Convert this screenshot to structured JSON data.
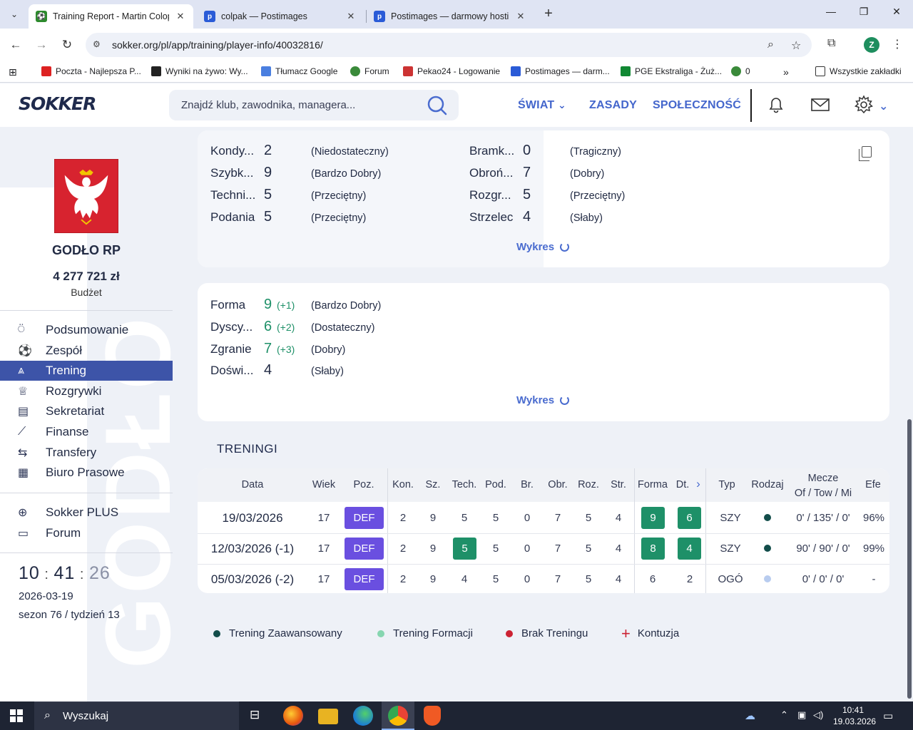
{
  "browser": {
    "tabs": [
      {
        "title": "Training Report - Martin Colopa",
        "active": true
      },
      {
        "title": "colpak — Postimages",
        "active": false
      },
      {
        "title": "Postimages — darmowy hosting",
        "active": false
      }
    ],
    "url": "sokker.org/pl/app/training/player-info/40032816/",
    "profile_initial": "Z",
    "bookmarks": [
      {
        "label": "Poczta - Najlepsza P...",
        "color": "#d22"
      },
      {
        "label": "Wyniki na żywo: Wy...",
        "color": "#222"
      },
      {
        "label": "Tłumacz Google",
        "color": "#4a7fe0"
      },
      {
        "label": "Forum",
        "color": "#3a8a3a"
      },
      {
        "label": "Pekao24 - Logowanie",
        "color": "#c33"
      },
      {
        "label": "Postimages — darm...",
        "color": "#2a5bd7"
      },
      {
        "label": "PGE Ekstraliga - Żuż...",
        "color": "#118833"
      },
      {
        "label": "0",
        "color": "#3a8a3a"
      }
    ],
    "all_bookmarks": "Wszystkie zakładki"
  },
  "header": {
    "logo": "SOKKER",
    "search_placeholder": "Znajdź klub, zawodnika, managera...",
    "nav": [
      "ŚWIAT",
      "ZASADY",
      "SPOŁECZNOŚĆ"
    ]
  },
  "sidebar": {
    "club_name": "GODŁO RP",
    "money": "4 277 721 zł",
    "budget_label": "Budżet",
    "watermark": "GODŁO",
    "menu": [
      {
        "label": "Podsumowanie",
        "icon": "medal-icon",
        "glyph": "⍥"
      },
      {
        "label": "Zespół",
        "icon": "ball-icon",
        "glyph": "⚽"
      },
      {
        "label": "Trening",
        "icon": "cone-icon",
        "glyph": "⩓",
        "active": true
      },
      {
        "label": "Rozgrywki",
        "icon": "trophy-icon",
        "glyph": "♕"
      },
      {
        "label": "Sekretariat",
        "icon": "briefcase-icon",
        "glyph": "▤"
      },
      {
        "label": "Finanse",
        "icon": "chart-icon",
        "glyph": "⟋"
      },
      {
        "label": "Transfery",
        "icon": "transfer-icon",
        "glyph": "⇆"
      },
      {
        "label": "Biuro Prasowe",
        "icon": "newspaper-icon",
        "glyph": "▦"
      }
    ],
    "menu2": [
      {
        "label": "Sokker PLUS",
        "icon": "plus-circle-icon",
        "glyph": "⊕"
      },
      {
        "label": "Forum",
        "icon": "chat-icon",
        "glyph": "▭"
      }
    ],
    "clock": {
      "h": "10",
      "m": "41",
      "s": "26"
    },
    "date": "2026-03-19",
    "season": "sezon 76 / tydzień 13"
  },
  "skills": {
    "left": [
      {
        "name": "Kondy...",
        "value": "2",
        "desc": "(Niedostateczny)"
      },
      {
        "name": "Szybk...",
        "value": "9",
        "desc": "(Bardzo Dobry)"
      },
      {
        "name": "Techni...",
        "value": "5",
        "desc": "(Przeciętny)"
      },
      {
        "name": "Podania",
        "value": "5",
        "desc": "(Przeciętny)"
      }
    ],
    "right": [
      {
        "name": "Bramk...",
        "value": "0",
        "desc": "(Tragiczny)"
      },
      {
        "name": "Obroń...",
        "value": "7",
        "desc": "(Dobry)"
      },
      {
        "name": "Rozgr...",
        "value": "5",
        "desc": "(Przeciętny)"
      },
      {
        "name": "Strzelec",
        "value": "4",
        "desc": "(Słaby)"
      }
    ],
    "chart_link": "Wykres"
  },
  "form": {
    "rows": [
      {
        "name": "Forma",
        "value": "9",
        "delta": "(+1)",
        "desc": "(Bardzo Dobry)",
        "green": true
      },
      {
        "name": "Dyscy...",
        "value": "6",
        "delta": "(+2)",
        "desc": "(Dostateczny)",
        "green": true
      },
      {
        "name": "Zgranie",
        "value": "7",
        "delta": "(+3)",
        "desc": "(Dobry)",
        "green": true
      },
      {
        "name": "Doświ...",
        "value": "4",
        "delta": "",
        "desc": "(Słaby)",
        "green": false
      }
    ],
    "chart_link": "Wykres"
  },
  "trainings": {
    "title": "TRENINGI",
    "headers": [
      "Data",
      "Wiek",
      "Poz.",
      "Kon.",
      "Sz.",
      "Tech.",
      "Pod.",
      "Br.",
      "Obr.",
      "Roz.",
      "Str.",
      "Forma",
      "Dt.",
      "Typ",
      "Rodzaj",
      "Mecze",
      "Of / Tow / Mi",
      "Efe"
    ],
    "rows": [
      {
        "date": "19/03/2026",
        "age": "17",
        "pos": "DEF",
        "kon": "2",
        "sz": "9",
        "tech": "5",
        "tech_hl": false,
        "pod": "5",
        "br": "0",
        "obr": "7",
        "roz": "5",
        "str": "4",
        "forma": "9",
        "forma_hl": true,
        "dt": "6",
        "dt_hl": true,
        "typ": "SZY",
        "dot": "#124d4a",
        "mecze": "0' / 135' / 0'",
        "efe": "96%"
      },
      {
        "date": "12/03/2026 (-1)",
        "age": "17",
        "pos": "DEF",
        "kon": "2",
        "sz": "9",
        "tech": "5",
        "tech_hl": true,
        "pod": "5",
        "br": "0",
        "obr": "7",
        "roz": "5",
        "str": "4",
        "forma": "8",
        "forma_hl": true,
        "dt": "4",
        "dt_hl": true,
        "typ": "SZY",
        "dot": "#124d4a",
        "mecze": "90' / 90' / 0'",
        "efe": "99%"
      },
      {
        "date": "05/03/2026 (-2)",
        "age": "17",
        "pos": "DEF",
        "kon": "2",
        "sz": "9",
        "tech": "4",
        "tech_hl": false,
        "pod": "5",
        "br": "0",
        "obr": "7",
        "roz": "5",
        "str": "4",
        "forma": "6",
        "forma_hl": false,
        "dt": "2",
        "dt_hl": false,
        "typ": "OGÓ",
        "dot": "#b8ccef",
        "mecze": "0' / 0' / 0'",
        "efe": "-"
      }
    ]
  },
  "legend": [
    {
      "label": "Trening Zaawansowany",
      "color": "#124d4a"
    },
    {
      "label": "Trening Formacji",
      "color": "#86d6b0"
    },
    {
      "label": "Brak Treningu",
      "color": "#cc2233"
    },
    {
      "label": "Kontuzja",
      "color": "#cc2233",
      "plus": true
    }
  ],
  "taskbar": {
    "search": "Wyszukaj",
    "time": "10:41",
    "date": "19.03.2026"
  }
}
